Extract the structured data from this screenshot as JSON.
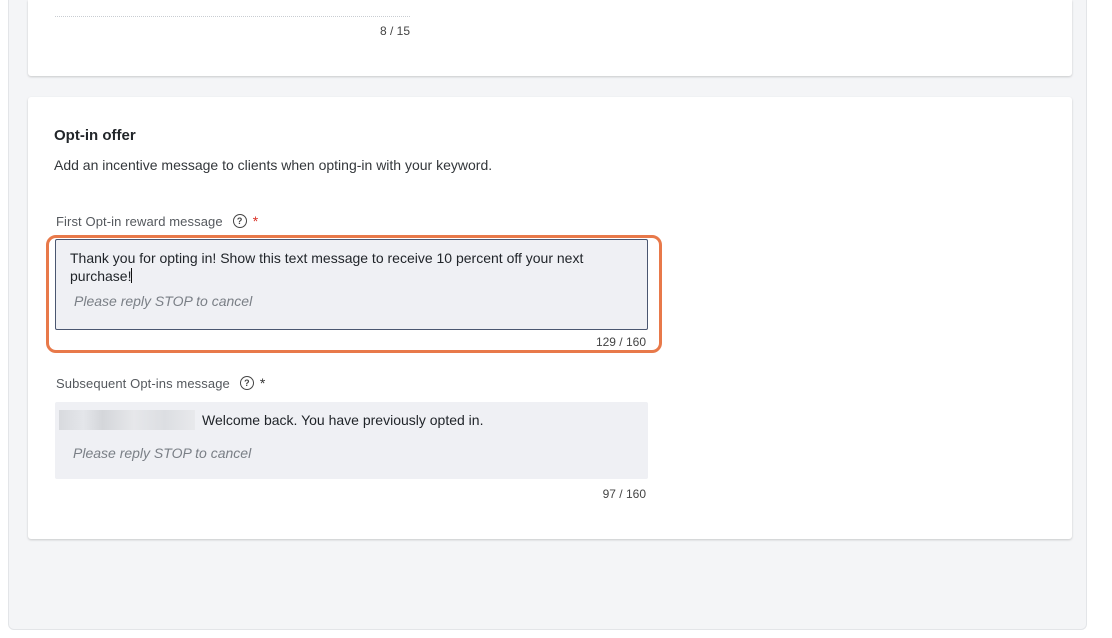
{
  "top_section": {
    "char_counter": "8 / 15"
  },
  "optin_offer": {
    "title": "Opt-in offer",
    "description": "Add an incentive message to clients when opting-in with your keyword.",
    "first_field": {
      "label": "First Opt-in reward message",
      "required_mark": "*",
      "value": "Thank you for opting in! Show this text message to receive 10 percent off your next purchase!",
      "footer": "Please reply STOP to cancel",
      "counter": "129 / 160"
    },
    "subsequent_field": {
      "label": "Subsequent Opt-ins message",
      "required_mark": "*",
      "value": "Welcome back. You have previously opted in.",
      "footer": "Please reply STOP to cancel",
      "counter": "97 / 160"
    }
  },
  "icons": {
    "help": "help-circle-icon"
  },
  "colors": {
    "highlight": "#e8794a",
    "required": "#d93025",
    "field_bg": "#eff0f4"
  }
}
